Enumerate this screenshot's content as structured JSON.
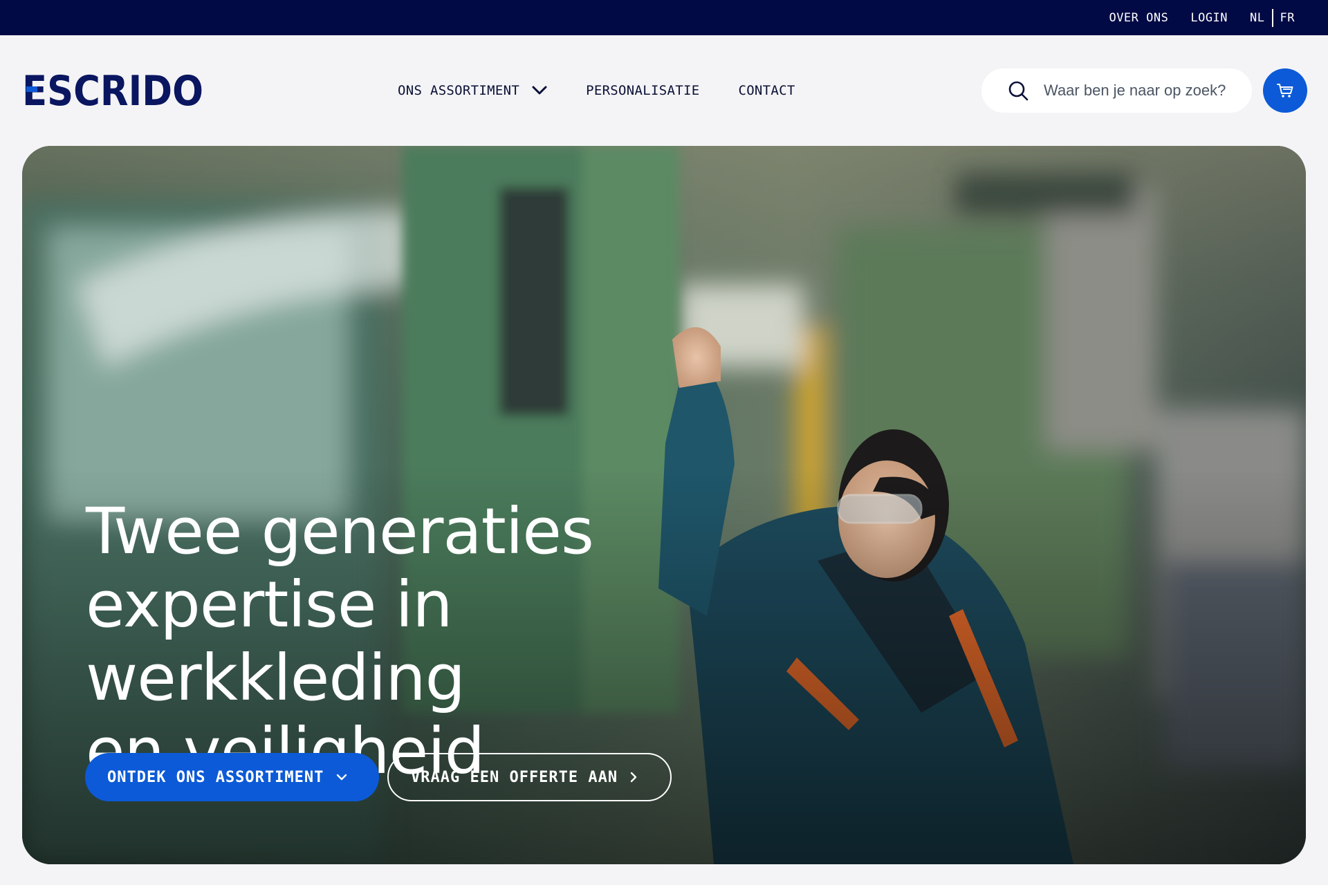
{
  "topbar": {
    "links": [
      "OVER ONS",
      "LOGIN"
    ],
    "languages": [
      "NL",
      "FR"
    ]
  },
  "brand": {
    "name": "ESCRIDO",
    "color": "#0a1660",
    "accent": "#0c5ad7"
  },
  "nav": {
    "items": [
      "ONS ASSORTIMENT",
      "PERSONALISATIE",
      "CONTACT"
    ]
  },
  "search": {
    "placeholder": "Waar ben je naar op zoek?",
    "icon": "search-icon"
  },
  "cart": {
    "icon": "cart-icon"
  },
  "hero": {
    "title_lines": [
      "Twee generaties",
      "expertise in werkkleding",
      "en veiligheid"
    ],
    "primary_cta": "ONTDEK ONS ASSORTIMENT",
    "secondary_cta": "VRAAG EEN OFFERTE AAN",
    "image": "factory-worker-photo"
  },
  "colors": {
    "topbar_bg": "#020a45",
    "page_bg": "#f4f4f6",
    "primary_button": "#0c5ad7"
  }
}
